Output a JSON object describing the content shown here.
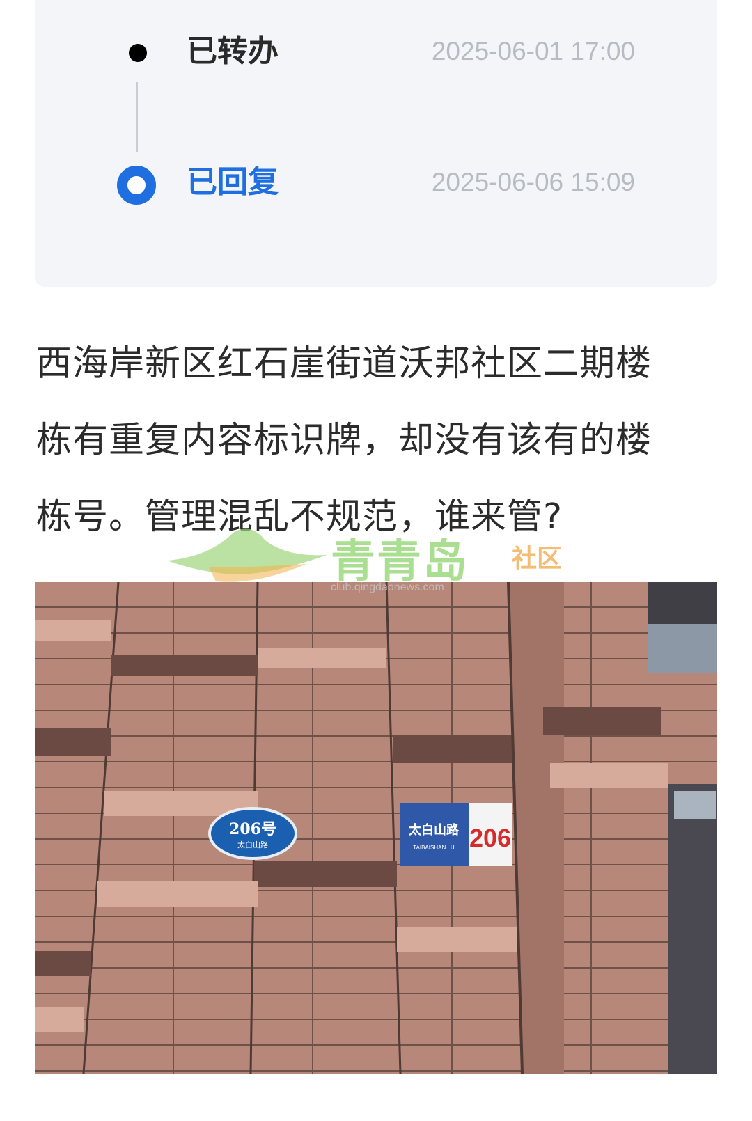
{
  "timeline": {
    "items": [
      {
        "label": "已转办",
        "time": "2025-06-01 17:00",
        "state": "done"
      },
      {
        "label": "已回复",
        "time": "2025-06-06 15:09",
        "state": "active"
      }
    ],
    "colors": {
      "active": "#1f6fe0",
      "done_dot": "#000000",
      "time": "#b7bcc3",
      "card_bg": "#f3f5f8"
    }
  },
  "post": {
    "lines": [
      "西海岸新区红石崖街道沃邦社区二期楼",
      "栋有重复内容标识牌，却没有该有的楼",
      "栋号。管理混乱不规范，谁来管?"
    ]
  },
  "watermark": {
    "name": "青青岛",
    "sub": "社区",
    "url": "club.qingdaonews.com"
  },
  "photo": {
    "sign_left": {
      "number": "206号",
      "sub": "太白山路"
    },
    "sign_right": {
      "road": "太白山路",
      "pinyin": "TAIBAISHAN LU",
      "number": "206"
    }
  }
}
